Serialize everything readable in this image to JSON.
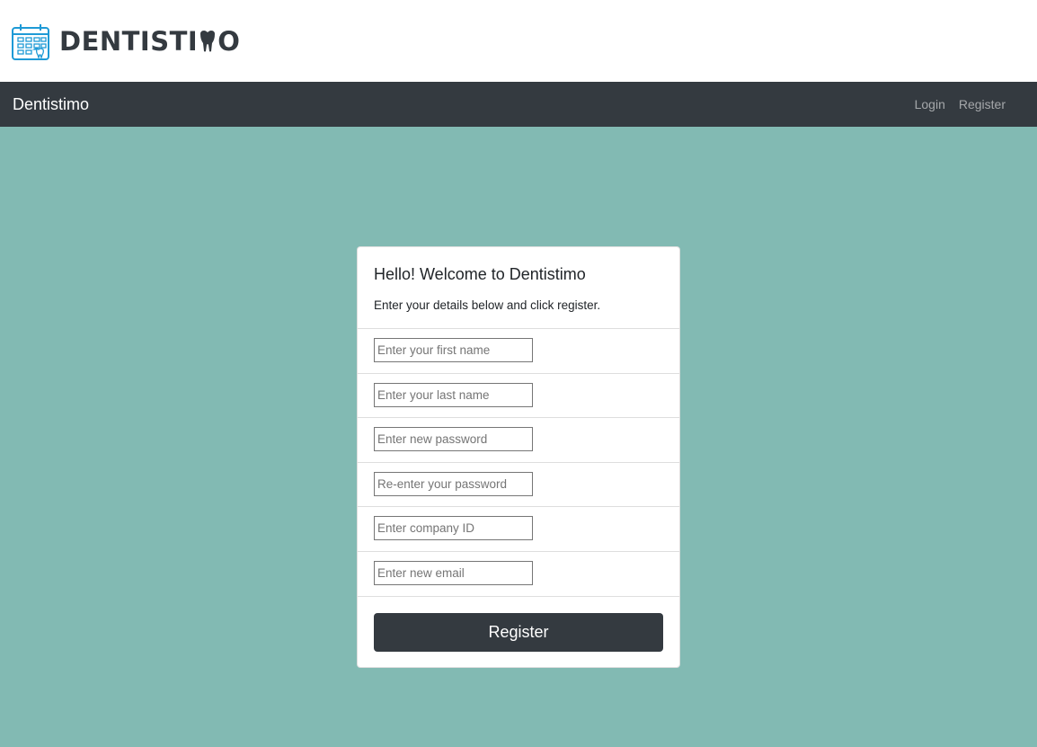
{
  "header": {
    "logo_text_part1": "DENTISTI",
    "logo_text_part2": "O",
    "logo_icon": "calendar-tooth-icon",
    "logo_color": "#1e9ad6"
  },
  "navbar": {
    "brand": "Dentistimo",
    "links": [
      {
        "label": "Login"
      },
      {
        "label": "Register"
      }
    ]
  },
  "form": {
    "title": "Hello! Welcome to Dentistimo",
    "subtitle": "Enter your details below and click register.",
    "fields": [
      {
        "placeholder": "Enter your first name",
        "value": ""
      },
      {
        "placeholder": "Enter your last name",
        "value": ""
      },
      {
        "placeholder": "Enter new password",
        "value": ""
      },
      {
        "placeholder": "Re-enter your password",
        "value": ""
      },
      {
        "placeholder": "Enter company ID",
        "value": ""
      },
      {
        "placeholder": "Enter new email",
        "value": ""
      }
    ],
    "submit_label": "Register"
  },
  "colors": {
    "background": "#82bab3",
    "navbar": "#343a40",
    "button": "#343a40"
  }
}
